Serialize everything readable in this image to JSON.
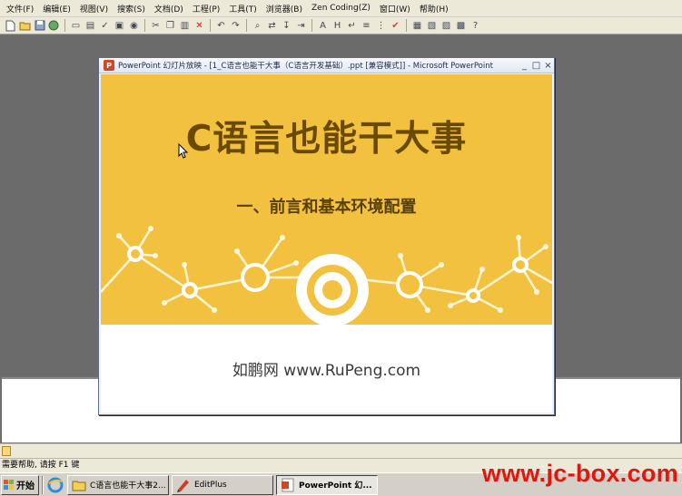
{
  "editplus": {
    "menu": [
      "文件(F)",
      "编辑(E)",
      "视图(V)",
      "搜索(S)",
      "文档(D)",
      "工程(P)",
      "工具(T)",
      "浏览器(B)",
      "Zen Coding(Z)",
      "窗口(W)",
      "帮助(H)"
    ],
    "status_text": "需要帮助, 请按 F1 键"
  },
  "ppt_window": {
    "title": "PowerPoint 幻灯片放映 - [1_C语言也能干大事（C语言开发基础）.ppt [兼容模式]] - Microsoft PowerPoint",
    "logo_letter": "P",
    "controls": {
      "minimize": "_",
      "maximize": "□",
      "close": "×"
    }
  },
  "slide": {
    "title": "C语言也能干大事",
    "subtitle": "一、前言和基本环境配置",
    "footer": "如鹏网 www.RuPeng.com",
    "colors": {
      "band": "#f2c13f",
      "title": "#6a4a00"
    }
  },
  "taskbar": {
    "start_label": "开始",
    "tasks": [
      {
        "label": "C语言也能干大事2...",
        "icon": "folder-icon",
        "active": false
      },
      {
        "label": "EditPlus",
        "icon": "editplus-icon",
        "active": false
      },
      {
        "label": "PowerPoint 幻...",
        "icon": "powerpoint-icon",
        "active": true
      }
    ]
  },
  "watermark": "www.jc-box.com"
}
